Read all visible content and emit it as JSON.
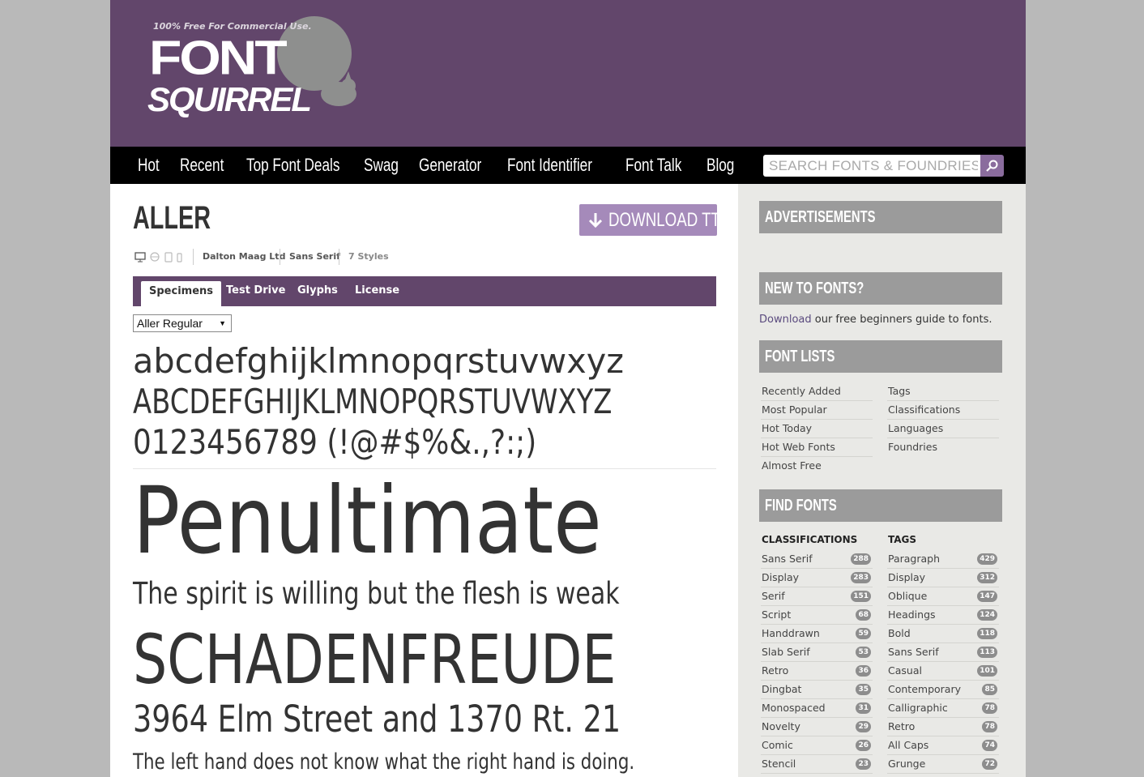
{
  "logo": {
    "tagline": "100% Free For Commercial Use.",
    "word1": "FONT",
    "word2": "SQUIRREL"
  },
  "nav": {
    "items": [
      "Hot",
      "Recent",
      "Top Font Deals",
      "Swag",
      "Generator",
      "Font Identifier",
      "Font Talk",
      "Blog"
    ],
    "search_placeholder": "SEARCH FONTS & FOUNDRIES",
    "search_icon": "search-icon"
  },
  "font": {
    "name": "ALLER",
    "download_label": "DOWNLOAD TTF",
    "foundry": "Dalton Maag Ltd",
    "classification": "Sans Serif",
    "styles": "7 Styles",
    "platform_icons": [
      "desktop-icon",
      "web-icon",
      "tablet-icon",
      "mobile-icon"
    ]
  },
  "tabs": [
    "Specimens",
    "Test Drive",
    "Glyphs",
    "License"
  ],
  "style_select": {
    "selected": "Aller Regular"
  },
  "specimen": {
    "lower": "abcdefghijklmnopqrstuvwxyz",
    "upper": "ABCDEFGHIJKLMNOPQRSTUVWXYZ",
    "numbers": "0123456789 (!@#$%&.,?:;)",
    "word": "Penultimate",
    "sentence": "The spirit is willing but the flesh is weak",
    "caps": "SCHADENFREUDE",
    "address": "3964 Elm Street and 1370 Rt. 21",
    "closing": "The left hand does not know what the right hand is doing."
  },
  "sidebar": {
    "ads_title": "ADVERTISEMENTS",
    "new_title": "NEW TO FONTS?",
    "new_link": "Download",
    "new_text": " our free beginners guide to fonts.",
    "lists_title": "FONT LISTS",
    "lists_left": [
      "Recently Added",
      "Most Popular",
      "Hot Today",
      "Hot Web Fonts",
      "Almost Free"
    ],
    "lists_right": [
      "Tags",
      "Classifications",
      "Languages",
      "Foundries"
    ],
    "find_title": "FIND FONTS",
    "classifications_head": "CLASSIFICATIONS",
    "tags_head": "TAGS",
    "classifications": [
      {
        "label": "Sans Serif",
        "count": "288"
      },
      {
        "label": "Display",
        "count": "283"
      },
      {
        "label": "Serif",
        "count": "151"
      },
      {
        "label": "Script",
        "count": "68"
      },
      {
        "label": "Handdrawn",
        "count": "59"
      },
      {
        "label": "Slab Serif",
        "count": "53"
      },
      {
        "label": "Retro",
        "count": "36"
      },
      {
        "label": "Dingbat",
        "count": "35"
      },
      {
        "label": "Monospaced",
        "count": "31"
      },
      {
        "label": "Novelty",
        "count": "29"
      },
      {
        "label": "Comic",
        "count": "26"
      },
      {
        "label": "Stencil",
        "count": "23"
      }
    ],
    "tags": [
      {
        "label": "Paragraph",
        "count": "429"
      },
      {
        "label": "Display",
        "count": "312"
      },
      {
        "label": "Oblique",
        "count": "147"
      },
      {
        "label": "Headings",
        "count": "124"
      },
      {
        "label": "Bold",
        "count": "118"
      },
      {
        "label": "Sans Serif",
        "count": "113"
      },
      {
        "label": "Casual",
        "count": "101"
      },
      {
        "label": "Contemporary",
        "count": "85"
      },
      {
        "label": "Calligraphic",
        "count": "78"
      },
      {
        "label": "Retro",
        "count": "78"
      },
      {
        "label": "All Caps",
        "count": "74"
      },
      {
        "label": "Grunge",
        "count": "72"
      }
    ]
  },
  "colors": {
    "brand": "#62466b",
    "accent": "#a58aba",
    "nav": "#000000",
    "sidebar_head": "#9b9b9b"
  }
}
